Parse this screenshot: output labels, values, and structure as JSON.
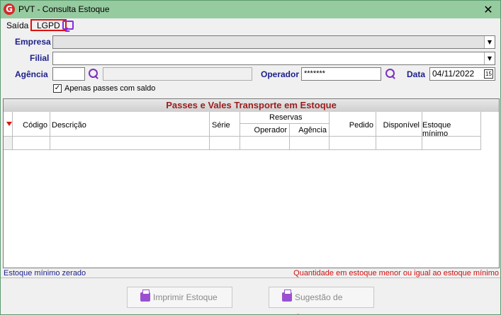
{
  "window": {
    "title": "PVT - Consulta Estoque",
    "close": "✕"
  },
  "menu": {
    "saida": "Saída",
    "lgpd": "LGPD"
  },
  "form": {
    "empresa_label": "Empresa",
    "filial_label": "Filial",
    "agencia_label": "Agência",
    "operador_label": "Operador",
    "operador_value": "*******",
    "data_label": "Data",
    "data_value": "04/11/2022",
    "calendar_glyph": "15",
    "checkbox_label": "Apenas passes com saldo",
    "checkbox_checked": "✓"
  },
  "grid": {
    "title": "Passes e Vales Transporte em Estoque",
    "columns": {
      "codigo": "Código",
      "descricao": "Descrição",
      "serie": "Série",
      "reservas": "Reservas",
      "operador": "Operador",
      "agencia": "Agência",
      "pedido": "Pedido",
      "disponivel": "Disponível",
      "estoque_minimo": "Estoque mínimo"
    }
  },
  "legend": {
    "left": "Estoque mínimo zerado",
    "right": "Quantidade em estoque menor ou igual ao estoque mínimo"
  },
  "buttons": {
    "imprimir": "Imprimir Estoque",
    "sugestao": "Sugestão de Compra"
  },
  "colors": {
    "title_bar": "#96cba0",
    "label": "#1b1f8a",
    "grid_title": "#9b1d1d",
    "alert": "#d01010",
    "icon": "#7b2fbe"
  }
}
